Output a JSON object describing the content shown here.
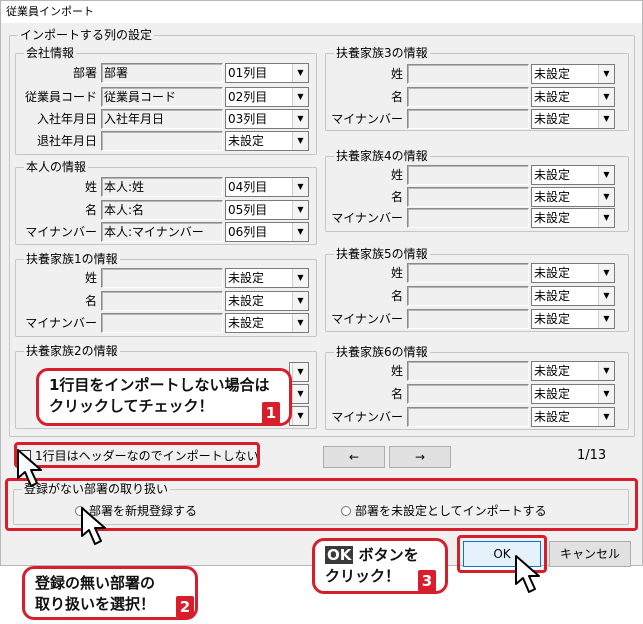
{
  "window": {
    "title": "従業員インポート"
  },
  "main_group": {
    "title": "インポートする列の設定"
  },
  "company": {
    "title": "会社情報",
    "rows": [
      {
        "label": "部署",
        "field": "部署",
        "select": "01列目"
      },
      {
        "label": "従業員コード",
        "field": "従業員コード",
        "select": "02列目"
      },
      {
        "label": "入社年月日",
        "field": "入社年月日",
        "select": "03列目"
      },
      {
        "label": "退社年月日",
        "field": "",
        "select": "未設定"
      }
    ]
  },
  "person": {
    "title": "本人の情報",
    "rows": [
      {
        "label": "姓",
        "field": "本人:姓",
        "select": "04列目"
      },
      {
        "label": "名",
        "field": "本人:名",
        "select": "05列目"
      },
      {
        "label": "マイナンバー",
        "field": "本人:マイナンバー",
        "select": "06列目"
      }
    ]
  },
  "family1": {
    "title": "扶養家族1の情報",
    "rows": [
      {
        "label": "姓",
        "field": "",
        "select": "未設定"
      },
      {
        "label": "名",
        "field": "",
        "select": "未設定"
      },
      {
        "label": "マイナンバー",
        "field": "",
        "select": "未設定"
      }
    ]
  },
  "family2": {
    "title": "扶養家族2の情報"
  },
  "family3": {
    "title": "扶養家族3の情報",
    "rows": [
      {
        "label": "姓",
        "field": "",
        "select": "未設定"
      },
      {
        "label": "名",
        "field": "",
        "select": "未設定"
      },
      {
        "label": "マイナンバー",
        "field": "",
        "select": "未設定"
      }
    ]
  },
  "family4": {
    "title": "扶養家族4の情報",
    "rows": [
      {
        "label": "姓",
        "field": "",
        "select": "未設定"
      },
      {
        "label": "名",
        "field": "",
        "select": "未設定"
      },
      {
        "label": "マイナンバー",
        "field": "",
        "select": "未設定"
      }
    ]
  },
  "family5": {
    "title": "扶養家族5の情報",
    "rows": [
      {
        "label": "姓",
        "field": "",
        "select": "未設定"
      },
      {
        "label": "名",
        "field": "",
        "select": "未設定"
      },
      {
        "label": "マイナンバー",
        "field": "",
        "select": "未設定"
      }
    ]
  },
  "family6": {
    "title": "扶養家族6の情報",
    "rows": [
      {
        "label": "姓",
        "field": "",
        "select": "未設定"
      },
      {
        "label": "名",
        "field": "",
        "select": "未設定"
      },
      {
        "label": "マイナンバー",
        "field": "",
        "select": "未設定"
      }
    ]
  },
  "header_checkbox": {
    "label": "1行目はヘッダーなのでインポートしない"
  },
  "pager": {
    "prev": "←",
    "next": "→",
    "page": "1/13"
  },
  "dept_group": {
    "title": "登録がない部署の取り扱い",
    "option_new": "部署を新規登録する",
    "option_unset": "部署を未設定としてインポートする"
  },
  "buttons": {
    "ok": "OK",
    "cancel": "キャンセル"
  },
  "icons": {
    "arrow": "chevron-down-icon",
    "cursor": "mouse-cursor-icon"
  },
  "callouts": {
    "c1": {
      "line1": "1行目をインポートしない場合は",
      "line2": "クリックしてチェック！",
      "num": "1"
    },
    "c2": {
      "line1": "登録の無い部署の",
      "line2": "取り扱いを選択！",
      "num": "2"
    },
    "c3": {
      "ok_tag": "OK",
      "line1": " ボタンを",
      "line2": "クリック！",
      "num": "3"
    }
  },
  "colors": {
    "accent": "#d81e2b",
    "window_bg": "#f0f0f0"
  }
}
